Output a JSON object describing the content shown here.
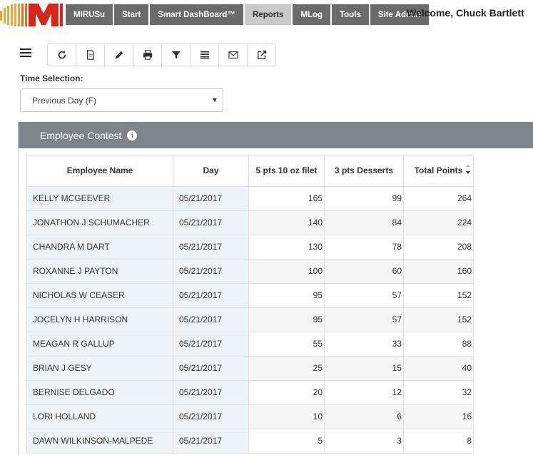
{
  "nav": {
    "items": [
      {
        "label": "MIRUSu",
        "active": false
      },
      {
        "label": "Start",
        "active": false
      },
      {
        "label": "Smart DashBoard™",
        "active": false
      },
      {
        "label": "Reports",
        "active": true
      },
      {
        "label": "MLog",
        "active": false
      },
      {
        "label": "Tools",
        "active": false
      },
      {
        "label": "Site Admin",
        "active": false
      }
    ],
    "welcome": "Welcome, Chuck Bartlett"
  },
  "toolbar": {
    "icons": [
      "refresh-icon",
      "document-icon",
      "pencil-icon",
      "print-icon",
      "filter-icon",
      "list-icon",
      "envelope-icon",
      "external-link-icon"
    ]
  },
  "time_selection": {
    "label": "Time Selection:",
    "value": "Previous Day (F)"
  },
  "panel": {
    "title": "Employee Contest",
    "header_color": "#7e858a"
  },
  "table": {
    "columns": [
      "Employee Name",
      "Day",
      "5 pts 10 oz filet",
      "3 pts Desserts",
      "Total Points"
    ],
    "rows": [
      [
        "KELLY MCGEEVER",
        "05/21/2017",
        "165",
        "99",
        "264"
      ],
      [
        "JONATHON J SCHUMACHER",
        "05/21/2017",
        "140",
        "84",
        "224"
      ],
      [
        "CHANDRA M DART",
        "05/21/2017",
        "130",
        "78",
        "208"
      ],
      [
        "ROXANNE J PAYTON",
        "05/21/2017",
        "100",
        "60",
        "160"
      ],
      [
        "NICHOLAS W CEASER",
        "05/21/2017",
        "95",
        "57",
        "152"
      ],
      [
        "JOCELYN H HARRISON",
        "05/21/2017",
        "95",
        "57",
        "152"
      ],
      [
        "MEAGAN R GALLUP",
        "05/21/2017",
        "55",
        "33",
        "88"
      ],
      [
        "BRIAN J GESY",
        "05/21/2017",
        "25",
        "15",
        "40"
      ],
      [
        "BERNISE DELGADO",
        "05/21/2017",
        "20",
        "12",
        "32"
      ],
      [
        "LORI HOLLAND",
        "05/21/2017",
        "10",
        "6",
        "16"
      ],
      [
        "DAWN WILKINSON-MALPEDE",
        "05/21/2017",
        "5",
        "3",
        "8"
      ]
    ]
  }
}
